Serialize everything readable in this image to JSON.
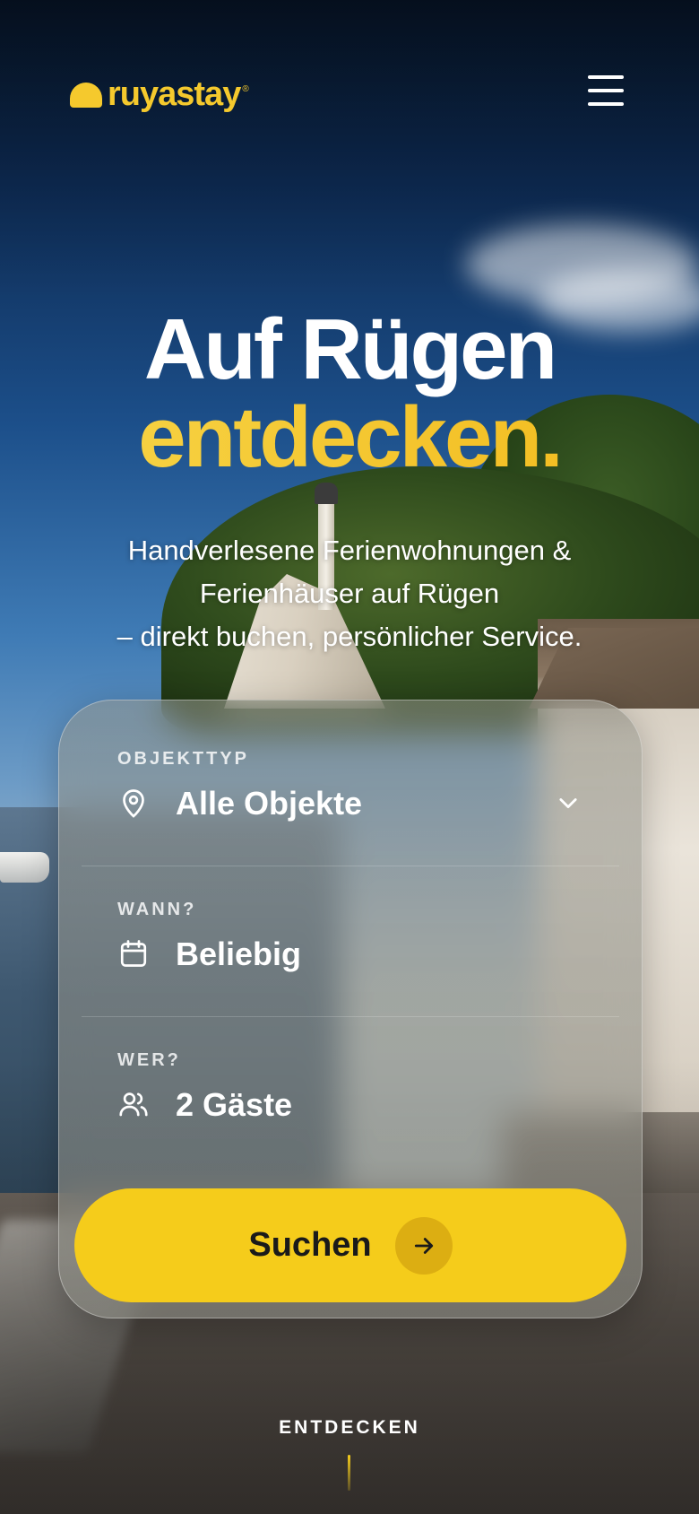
{
  "brand": {
    "name": "ruyastay",
    "trademark": "®",
    "color": "#f5c92d"
  },
  "header": {
    "menu_icon": "hamburger-menu-icon"
  },
  "hero": {
    "title_line1": "Auf Rügen",
    "title_line2": "entdecken.",
    "subtitle_line1": "Handverlesene Ferienwohnungen &",
    "subtitle_line2": "Ferienhäuser auf Rügen",
    "subtitle_line3": "– direkt buchen, persönlicher Service."
  },
  "search": {
    "type": {
      "label": "OBJEKTTYP",
      "value": "Alle Objekte",
      "icon": "map-pin-icon",
      "dropdown_icon": "chevron-down-icon"
    },
    "when": {
      "label": "WANN?",
      "value": "Beliebig",
      "icon": "calendar-icon"
    },
    "who": {
      "label": "WER?",
      "value": "2 Gäste",
      "icon": "users-icon"
    },
    "button": {
      "label": "Suchen",
      "icon": "arrow-right-icon",
      "color": "#f5cc1b"
    }
  },
  "scroll_hint": {
    "label": "ENTDECKEN"
  }
}
